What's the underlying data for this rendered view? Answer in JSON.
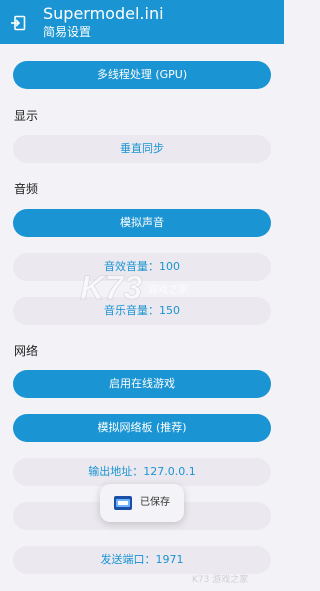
{
  "app": {
    "title": "Supermodel.ini",
    "subtitle": "简易设置"
  },
  "colors": {
    "primary": "#1a94d2",
    "tonal_background": "#ebe9ef",
    "page_background": "#f3f2f7"
  },
  "buttons": {
    "multithread": "多线程处理 (GPU)",
    "vsync": "垂直同步",
    "emulate_sound": "模拟声音",
    "sfx_volume": "音效音量：100",
    "music_volume": "音乐音量：150",
    "enable_online": "启用在线游戏",
    "emulate_netboard": "模拟网络板 (推荐)",
    "output_address": "输出地址：127.0.0.1",
    "send_port": "发送端口：1971"
  },
  "sections": {
    "display": "显示",
    "audio": "音频",
    "network": "网络"
  },
  "toast": {
    "message": "已保存",
    "icon": "app-logo-icon"
  },
  "watermark": {
    "logo": "K73",
    "text": "游戏之家",
    "corner": "K73 游戏之家"
  }
}
